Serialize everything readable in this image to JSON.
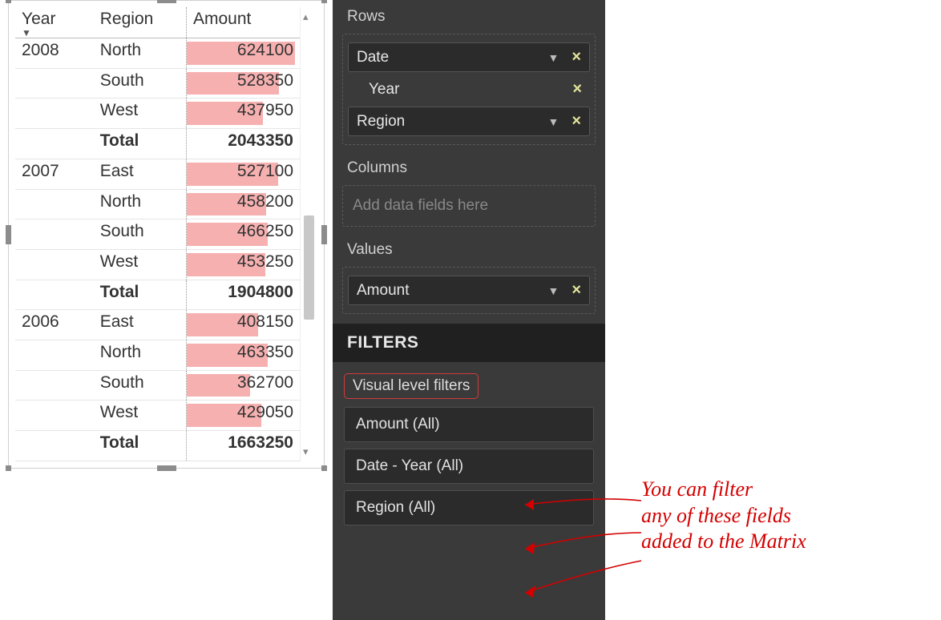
{
  "matrix": {
    "headers": {
      "year": "Year",
      "region": "Region",
      "amount": "Amount"
    },
    "max_amount": 650000,
    "groups": [
      {
        "year": "2008",
        "rows": [
          {
            "region": "North",
            "amount": 624100
          },
          {
            "region": "South",
            "amount": 528350
          },
          {
            "region": "West",
            "amount": 437950
          }
        ],
        "total_label": "Total",
        "total": 2043350
      },
      {
        "year": "2007",
        "rows": [
          {
            "region": "East",
            "amount": 527100
          },
          {
            "region": "North",
            "amount": 458200
          },
          {
            "region": "South",
            "amount": 466250
          },
          {
            "region": "West",
            "amount": 453250
          }
        ],
        "total_label": "Total",
        "total": 1904800
      },
      {
        "year": "2006",
        "rows": [
          {
            "region": "East",
            "amount": 408150
          },
          {
            "region": "North",
            "amount": 463350
          },
          {
            "region": "South",
            "amount": 362700
          },
          {
            "region": "West",
            "amount": 429050
          }
        ],
        "total_label": "Total",
        "total": 1663250
      }
    ]
  },
  "panel": {
    "rows_label": "Rows",
    "row_fields": {
      "date": "Date",
      "year": "Year",
      "region": "Region"
    },
    "columns_label": "Columns",
    "columns_placeholder": "Add data fields here",
    "values_label": "Values",
    "value_fields": {
      "amount": "Amount"
    },
    "filters_header": "FILTERS",
    "visual_level_filters": "Visual level filters",
    "filters": {
      "amount": "Amount  (All)",
      "date_year": "Date - Year  (All)",
      "region": "Region  (All)"
    }
  },
  "annotation": {
    "line1": "You can filter",
    "line2": "any of these fields",
    "line3": "added to the Matrix"
  }
}
